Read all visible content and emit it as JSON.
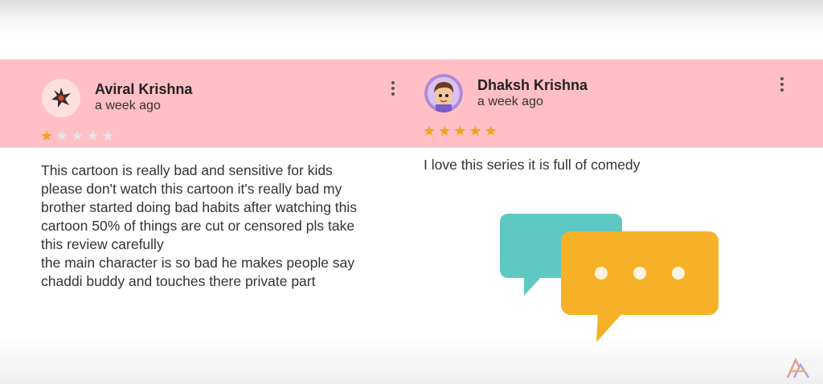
{
  "reviews": [
    {
      "name": "Aviral Krishna",
      "time": "a week ago",
      "rating": 1,
      "text_lines": [
        "This cartoon is really bad and sensitive for kids",
        "please don't watch this cartoon it's really bad my",
        "brother started doing bad habits after watching this",
        "cartoon 50% of things are cut or censored pls take",
        "this review carefully",
        "the main character is so bad he makes people say",
        "chaddi buddy and touches there private part"
      ]
    },
    {
      "name": "Dhaksh Krishna",
      "time": "a week ago",
      "rating": 5,
      "text_lines": [
        "I love this series it is full of comedy"
      ]
    }
  ],
  "colors": {
    "band": "#ffbfc4",
    "star_filled": "#f4a11c",
    "star_empty": "#e3e3e3",
    "bubble_back": "#5ec9c2",
    "bubble_front": "#f6b128"
  },
  "icons": [
    "more-vert-icon",
    "star-icon",
    "chat-bubbles-illustration",
    "brand-logo"
  ]
}
